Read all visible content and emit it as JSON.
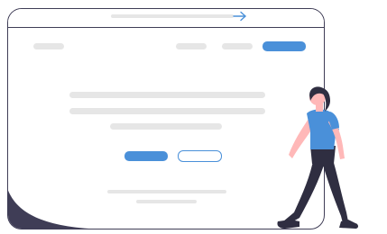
{
  "illustration": {
    "subject": "person-walking-past-browser-window",
    "icons": {
      "go_arrow": "arrow-right-icon"
    },
    "colors": {
      "outline": "#3f3d56",
      "accent": "#4a90d9",
      "placeholder": "#e6e6e6",
      "shirt": "#4a90d9",
      "pants": "#2f2e41",
      "skin": "#ffb8b8",
      "hair": "#2f2e41"
    }
  }
}
